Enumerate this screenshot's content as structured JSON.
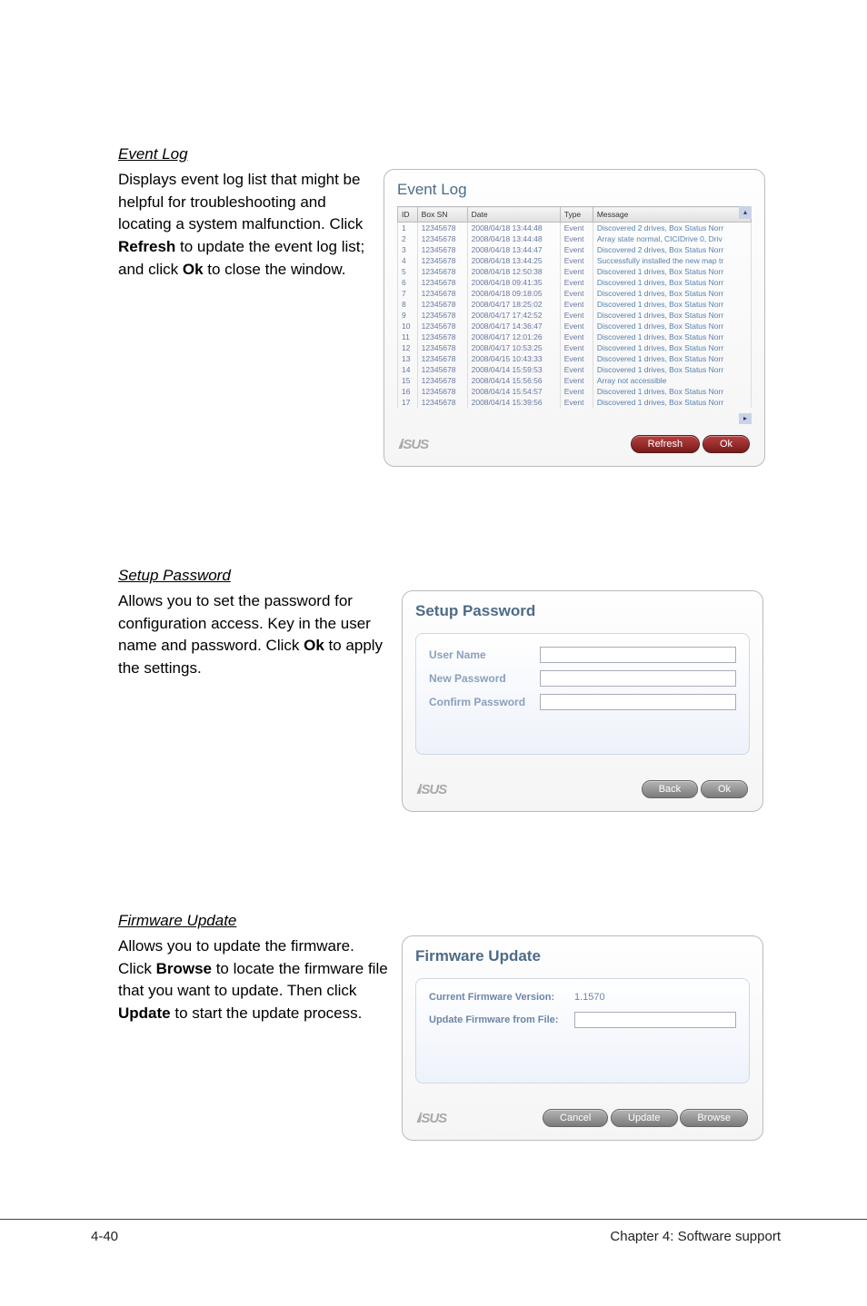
{
  "sections": {
    "eventLog": {
      "title": "Event Log",
      "text_parts": [
        "Displays event log list that might be helpful for troubleshooting and locating a system malfunction. Click ",
        "Refresh",
        " to update the event log list; and click ",
        "Ok",
        " to close the window."
      ]
    },
    "setupPassword": {
      "title": "Setup Password",
      "text_parts": [
        "Allows you to set the password for configuration access. Key in the user name and password. Click ",
        "Ok",
        " to apply the settings."
      ]
    },
    "firmwareUpdate": {
      "title": "Firmware Update",
      "text_parts": [
        "Allows you to update the firmware. Click ",
        "Browse",
        " to locate the firmware file that you want to update. Then click ",
        "Update",
        " to start the update process."
      ]
    }
  },
  "eventLogWindow": {
    "title": "Event Log",
    "columns": [
      "ID",
      "Box SN",
      "Date",
      "Type",
      "Message"
    ],
    "rows": [
      {
        "id": "1",
        "sn": "12345678",
        "date": "2008/04/18 13:44:48",
        "type": "Event",
        "msg": "Discovered 2 drives, Box Status Norr"
      },
      {
        "id": "2",
        "sn": "12345678",
        "date": "2008/04/18 13:44:48",
        "type": "Event",
        "msg": "Array state normal, CICIDrive 0, Driv"
      },
      {
        "id": "3",
        "sn": "12345678",
        "date": "2008/04/18 13:44:47",
        "type": "Event",
        "msg": "Discovered 2 drives, Box Status Norr"
      },
      {
        "id": "4",
        "sn": "12345678",
        "date": "2008/04/18 13:44:25",
        "type": "Event",
        "msg": "Successfully installed the new map tr"
      },
      {
        "id": "5",
        "sn": "12345678",
        "date": "2008/04/18 12:50:38",
        "type": "Event",
        "msg": "Discovered 1 drives, Box Status Norr"
      },
      {
        "id": "6",
        "sn": "12345678",
        "date": "2008/04/18 09:41:35",
        "type": "Event",
        "msg": "Discovered 1 drives, Box Status Norr"
      },
      {
        "id": "7",
        "sn": "12345678",
        "date": "2008/04/18 09:18:05",
        "type": "Event",
        "msg": "Discovered 1 drives, Box Status Norr"
      },
      {
        "id": "8",
        "sn": "12345678",
        "date": "2008/04/17 18:25:02",
        "type": "Event",
        "msg": "Discovered 1 drives, Box Status Norr"
      },
      {
        "id": "9",
        "sn": "12345678",
        "date": "2008/04/17 17:42:52",
        "type": "Event",
        "msg": "Discovered 1 drives, Box Status Norr"
      },
      {
        "id": "10",
        "sn": "12345678",
        "date": "2008/04/17 14:36:47",
        "type": "Event",
        "msg": "Discovered 1 drives, Box Status Norr"
      },
      {
        "id": "11",
        "sn": "12345678",
        "date": "2008/04/17 12:01:26",
        "type": "Event",
        "msg": "Discovered 1 drives, Box Status Norr"
      },
      {
        "id": "12",
        "sn": "12345678",
        "date": "2008/04/17 10:53:25",
        "type": "Event",
        "msg": "Discovered 1 drives, Box Status Norr"
      },
      {
        "id": "13",
        "sn": "12345678",
        "date": "2008/04/15 10:43:33",
        "type": "Event",
        "msg": "Discovered 1 drives, Box Status Norr"
      },
      {
        "id": "14",
        "sn": "12345678",
        "date": "2008/04/14 15:59:53",
        "type": "Event",
        "msg": "Discovered 1 drives, Box Status Norr"
      },
      {
        "id": "15",
        "sn": "12345678",
        "date": "2008/04/14 15:56:56",
        "type": "Event",
        "msg": "Array not accessible"
      },
      {
        "id": "16",
        "sn": "12345678",
        "date": "2008/04/14 15:54:57",
        "type": "Event",
        "msg": "Discovered 1 drives, Box Status Norr"
      },
      {
        "id": "17",
        "sn": "12345678",
        "date": "2008/04/14 15:39:56",
        "type": "Event",
        "msg": "Discovered 1 drives, Box Status Norr"
      }
    ],
    "buttons": {
      "refresh": "Refresh",
      "ok": "Ok"
    }
  },
  "passwordWindow": {
    "title": "Setup Password",
    "labels": {
      "user": "User Name",
      "new": "New Password",
      "confirm": "Confirm Password"
    },
    "buttons": {
      "back": "Back",
      "ok": "Ok"
    }
  },
  "firmwareWindow": {
    "title": "Firmware Update",
    "labels": {
      "version": "Current Firmware Version:",
      "from": "Update Firmware from File:"
    },
    "versionValue": "1.1570",
    "buttons": {
      "cancel": "Cancel",
      "update": "Update",
      "browse": "Browse"
    }
  },
  "footer": {
    "left": "4-40",
    "right": "Chapter 4: Software support"
  },
  "logo": "iSUS"
}
